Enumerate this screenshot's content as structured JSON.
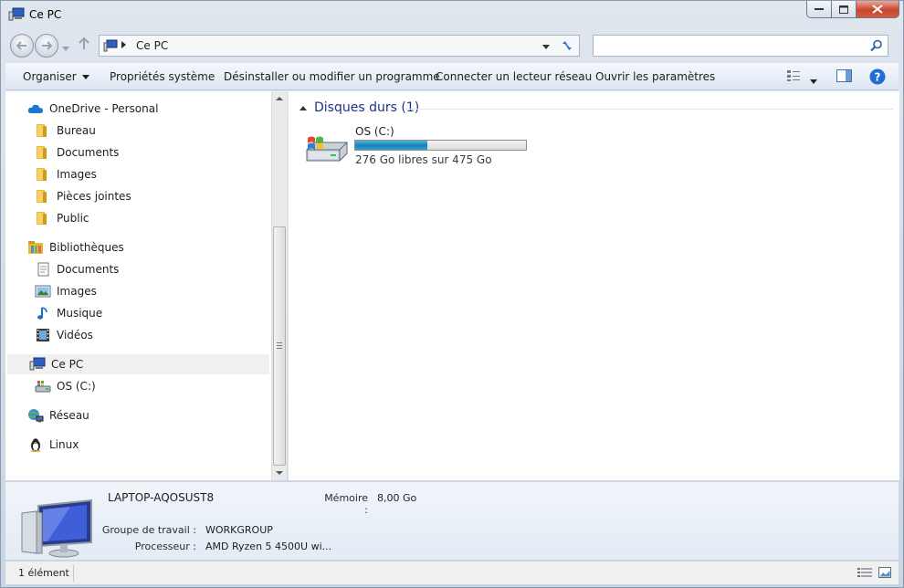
{
  "window": {
    "title": "Ce PC",
    "icon": "computer-icon"
  },
  "address": {
    "path": "Ce PC",
    "search_placeholder": ""
  },
  "commands": [
    {
      "label": "Organiser",
      "has_dropdown": true
    },
    {
      "label": "Propriétés système"
    },
    {
      "label": "Désinstaller ou modifier un programme"
    },
    {
      "label": "Connecter un lecteur réseau"
    },
    {
      "label": "Ouvrir les paramètres"
    }
  ],
  "nav": {
    "onedrive": {
      "label": "OneDrive - Personal",
      "icon": "cloud-icon"
    },
    "onedrive_items": [
      {
        "label": "Bureau",
        "icon": "folder-icon"
      },
      {
        "label": "Documents",
        "icon": "folder-icon"
      },
      {
        "label": "Images",
        "icon": "folder-icon"
      },
      {
        "label": "Pièces jointes",
        "icon": "folder-icon"
      },
      {
        "label": "Public",
        "icon": "folder-icon"
      }
    ],
    "libraries": {
      "label": "Bibliothèques",
      "icon": "library-icon"
    },
    "library_items": [
      {
        "label": "Documents",
        "icon": "document-icon"
      },
      {
        "label": "Images",
        "icon": "picture-icon"
      },
      {
        "label": "Musique",
        "icon": "music-note-icon"
      },
      {
        "label": "Vidéos",
        "icon": "film-icon"
      }
    ],
    "thispc": {
      "label": "Ce PC",
      "icon": "computer-icon"
    },
    "thispc_items": [
      {
        "label": "OS (C:)",
        "icon": "drive-icon"
      }
    ],
    "network": {
      "label": "Réseau",
      "icon": "network-icon"
    },
    "linux": {
      "label": "Linux",
      "icon": "penguin-icon"
    }
  },
  "content": {
    "group_title": "Disques durs (1)",
    "drives": [
      {
        "name": "OS (C:)",
        "free_text": "276 Go libres sur 475 Go",
        "used_fraction": 0.42
      }
    ]
  },
  "details": {
    "computer_name": "LAPTOP-AQOSUST8",
    "workgroup_label": "Groupe de travail :",
    "workgroup_value": "WORKGROUP",
    "processor_label": "Processeur :",
    "processor_value": "AMD Ryzen 5 4500U wi...",
    "memory_label": "Mémoire :",
    "memory_value": "8,00 Go"
  },
  "status": {
    "text": "1 élément"
  },
  "colors": {
    "accent": "#1e3287",
    "progress": "#1a7fb5",
    "help": "#1e6fd0"
  }
}
